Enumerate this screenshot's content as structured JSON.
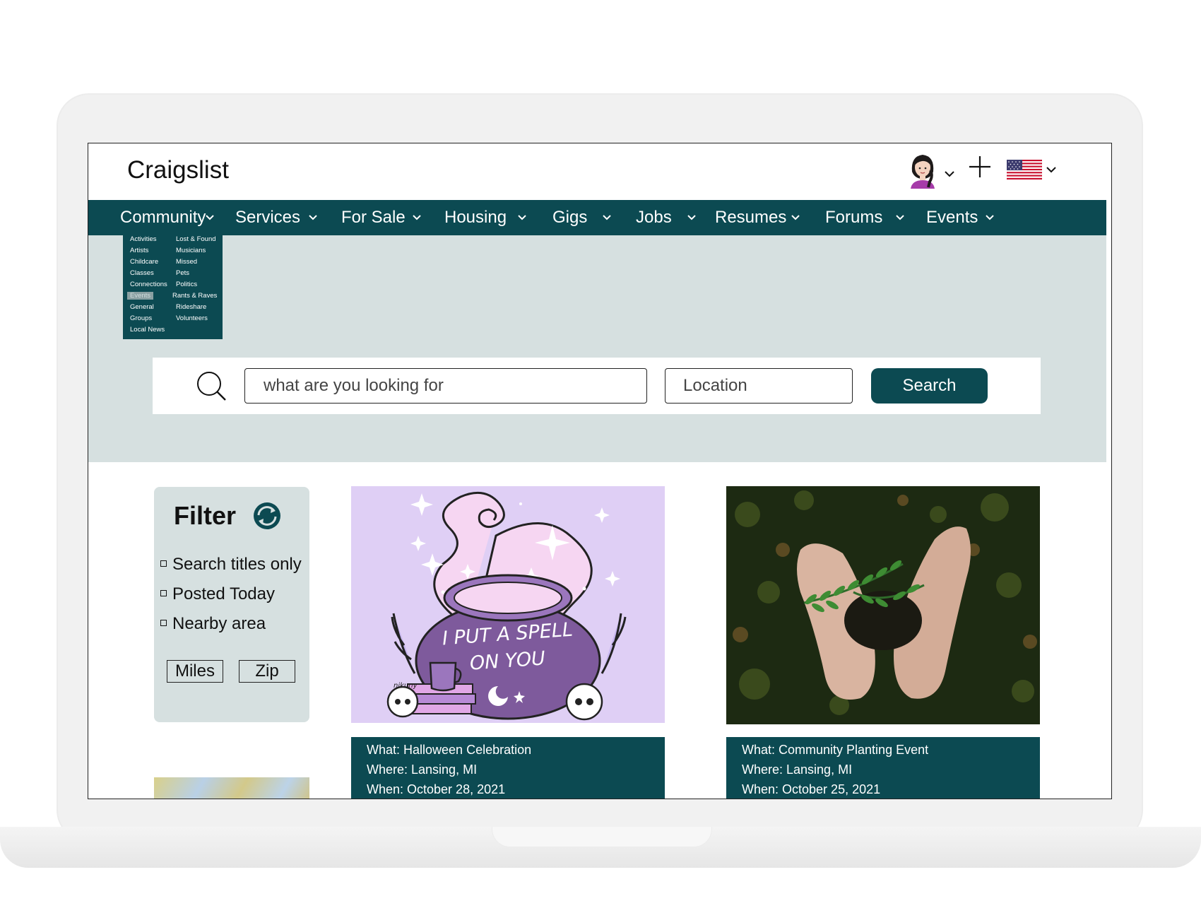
{
  "header": {
    "brand": "Craigslist"
  },
  "nav": {
    "items": [
      {
        "label": "Community"
      },
      {
        "label": "Services"
      },
      {
        "label": "For Sale"
      },
      {
        "label": "Housing"
      },
      {
        "label": "Gigs"
      },
      {
        "label": "Jobs"
      },
      {
        "label": "Resumes"
      },
      {
        "label": "Forums"
      },
      {
        "label": "Events"
      }
    ]
  },
  "community_menu": {
    "left": [
      "Activities",
      "Artists",
      "Childcare",
      "Classes",
      "Connections",
      "Events",
      "General",
      "Groups",
      "Local News"
    ],
    "right": [
      "Lost & Found",
      "Musicians",
      "Missed",
      "Pets",
      "Politics",
      "Rants & Raves",
      "Rideshare",
      "Volunteers"
    ],
    "active": "Events"
  },
  "search": {
    "query_placeholder": "what are you looking for",
    "location_placeholder": "Location",
    "button_label": "Search"
  },
  "filter": {
    "title": "Filter",
    "options": [
      "Search titles only",
      "Posted Today",
      "Nearby area"
    ],
    "miles_label": "Miles",
    "zip_label": "Zip"
  },
  "events": [
    {
      "what": "What: Halloween Celebration",
      "where": "Where: Lansing, MI",
      "when": "When: October 28, 2021",
      "image_text": [
        "I PUT A SPELL",
        "ON YOU"
      ],
      "artist_tag": "nikuny"
    },
    {
      "what": "What: Community Planting Event",
      "where": "Where: Lansing, MI",
      "when": "When: October 25, 2021"
    }
  ],
  "colors": {
    "brand_teal": "#0c4a52",
    "hero_bg": "#d6e0e0",
    "halloween_bg": "#dfcff5",
    "cauldron": "#7e5a9c"
  },
  "icons": [
    "user-avatar",
    "chevron-down-icon",
    "plus-icon",
    "us-flag-icon",
    "search-icon",
    "refresh-icon"
  ]
}
